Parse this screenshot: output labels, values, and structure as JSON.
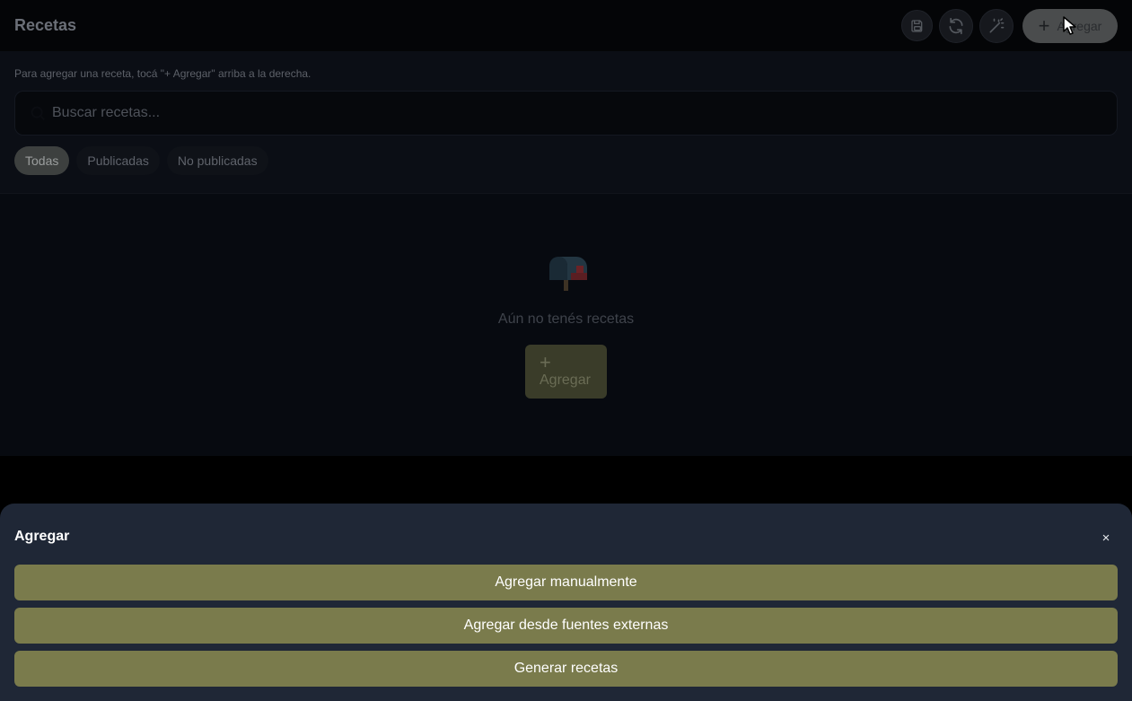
{
  "header": {
    "title": "Recetas",
    "add_label": "Agregar",
    "icons": [
      "save-icon",
      "refresh-icon",
      "magic-wand-icon",
      "plus-icon"
    ]
  },
  "filters": {
    "hint": "Para agregar una receta, tocá \"+ Agregar\" arriba a la derecha.",
    "search_placeholder": "Buscar recetas...",
    "tabs": [
      {
        "label": "Todas",
        "active": true
      },
      {
        "label": "Publicadas",
        "active": false
      },
      {
        "label": "No publicadas",
        "active": false
      }
    ]
  },
  "empty_state": {
    "icon": "mailbox-icon",
    "message": "Aún no tenés recetas",
    "add_plus": "+",
    "add_label": "Agregar"
  },
  "sheet": {
    "title": "Agregar",
    "close_label": "×",
    "options": [
      "Agregar manualmente",
      "Agregar desde fuentes externas",
      "Generar recetas"
    ]
  },
  "colors": {
    "accent": "#7a7b4c",
    "sheet_bg": "#1f2736",
    "page_bg": "#000000"
  }
}
